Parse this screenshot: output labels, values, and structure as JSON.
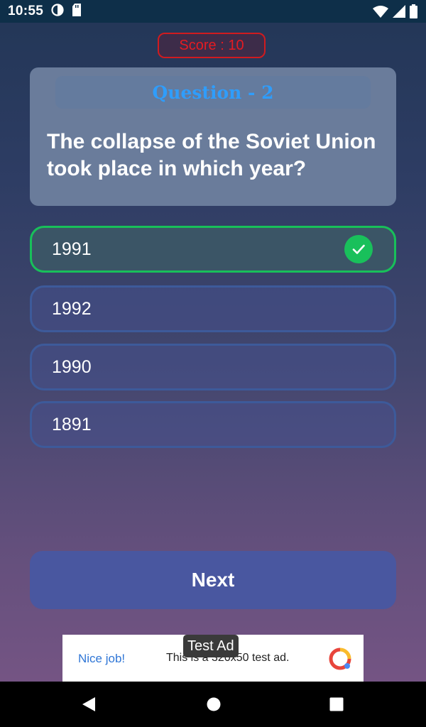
{
  "status_bar": {
    "time": "10:55",
    "icons": [
      "data-saver-icon",
      "sd-card-icon",
      "wifi-icon",
      "signal-icon",
      "battery-icon"
    ]
  },
  "score": "Score : 10",
  "question": {
    "header": "Question - 2",
    "text": "The collapse of the Soviet Union took place in which year?"
  },
  "options": [
    {
      "label": "1991",
      "state": "correct"
    },
    {
      "label": "1992",
      "state": "default"
    },
    {
      "label": "1990",
      "state": "default"
    },
    {
      "label": "1891",
      "state": "default"
    }
  ],
  "next_label": "Next",
  "ad": {
    "badge": "Test Ad",
    "cta": "Nice job!",
    "text": "This is a 320x50 test ad."
  },
  "colors": {
    "correct": "#19c05b",
    "score_red": "#e51b22",
    "question_header": "#2f9dfb",
    "next_button": "#4957a0"
  }
}
